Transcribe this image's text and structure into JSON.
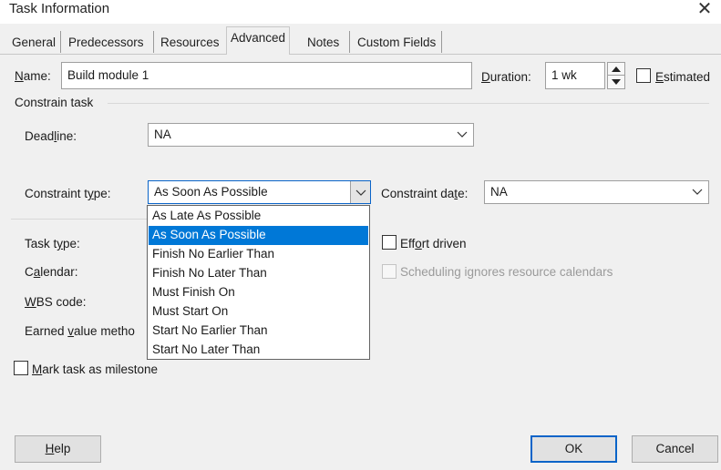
{
  "window": {
    "title": "Task Information"
  },
  "tabs": [
    {
      "label": "General"
    },
    {
      "label": "Predecessors"
    },
    {
      "label": "Resources"
    },
    {
      "label": "Advanced"
    },
    {
      "label": "Notes"
    },
    {
      "label": "Custom Fields"
    }
  ],
  "name_field": {
    "label_pre": "",
    "label_ul": "N",
    "label_post": "ame:",
    "value": "Build module 1"
  },
  "duration_field": {
    "label_ul": "D",
    "label_post": "uration:",
    "value": "1 wk"
  },
  "estimated": {
    "label_ul": "E",
    "label_post": "stimated"
  },
  "constrain_group": {
    "title": "Constrain task"
  },
  "deadline": {
    "label_pre": "Dead",
    "label_ul": "l",
    "label_post": "ine:",
    "value": "NA"
  },
  "constraint_type": {
    "label_pre": "Constraint t",
    "label_ul": "y",
    "label_post": "pe:",
    "value": "As Soon As Possible"
  },
  "constraint_date": {
    "label_pre": "Constraint da",
    "label_ul": "t",
    "label_post": "e:",
    "value": "NA"
  },
  "dropdown_options": [
    "As Late As Possible",
    "As Soon As Possible",
    "Finish No Earlier Than",
    "Finish No Later Than",
    "Must Finish On",
    "Must Start On",
    "Start No Earlier Than",
    "Start No Later Than"
  ],
  "task_type": {
    "label_pre": "Task t",
    "label_ul": "y",
    "label_post": "pe:"
  },
  "calendar": {
    "label_pre": "C",
    "label_ul": "a",
    "label_post": "lendar:"
  },
  "wbs_code": {
    "label_pre": "",
    "label_ul": "W",
    "label_post": "BS code:"
  },
  "earned_value": {
    "label_pre": "Earned ",
    "label_ul": "v",
    "label_post": "alue metho"
  },
  "effort_driven": {
    "label_pre": "Eff",
    "label_ul": "o",
    "label_post": "rt driven"
  },
  "scheduling_ignores": {
    "label": "Scheduling ignores resource calendars"
  },
  "milestone": {
    "label_pre": "",
    "label_ul": "M",
    "label_post": "ark task as milestone"
  },
  "buttons": {
    "help_ul": "H",
    "help_post": "elp",
    "ok": "OK",
    "cancel": "Cancel"
  },
  "colors": {
    "accent": "#0078d7",
    "dialog_bg": "#f0f0f0"
  }
}
